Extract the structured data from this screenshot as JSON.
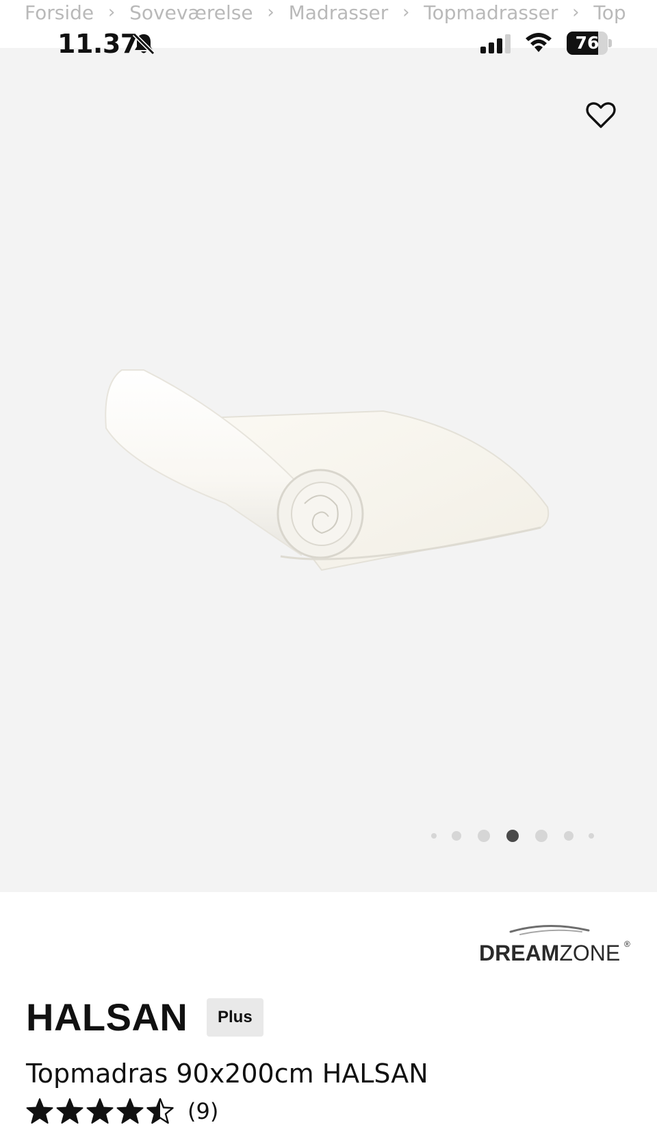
{
  "breadcrumb": {
    "items": [
      {
        "label": "Forside"
      },
      {
        "label": "Soveværelse"
      },
      {
        "label": "Madrasser"
      },
      {
        "label": "Topmadrasser"
      },
      {
        "label": "Top"
      }
    ],
    "separator": "›"
  },
  "status_bar": {
    "time": "11.37",
    "battery_level": "76",
    "battery_fraction": 0.76,
    "icons": [
      "bell-slash-icon",
      "cellular-signal-icon",
      "wifi-icon",
      "battery-icon"
    ]
  },
  "gallery": {
    "favorite_icon": "heart-outline-icon",
    "image_alt_subject": "rolled topper mattress",
    "dot_count": 7,
    "active_dot_index": 3,
    "background_color": "#f3f3f3"
  },
  "brand": {
    "logo_text_bold": "DREAM",
    "logo_text_light": "ZONE",
    "logo_mark": "®"
  },
  "product": {
    "name": "HALSAN",
    "badge": "Plus",
    "description": "Topmadras 90x200cm HALSAN",
    "rating_value": 4.5,
    "rating_max": 5,
    "rating_count": "(9)"
  },
  "colors": {
    "text": "#111111",
    "muted": "#b9b9b9",
    "badge_bg": "#e9e9e9",
    "dot_active": "#4a4a4a",
    "dot_inactive": "#d6d6d6"
  }
}
